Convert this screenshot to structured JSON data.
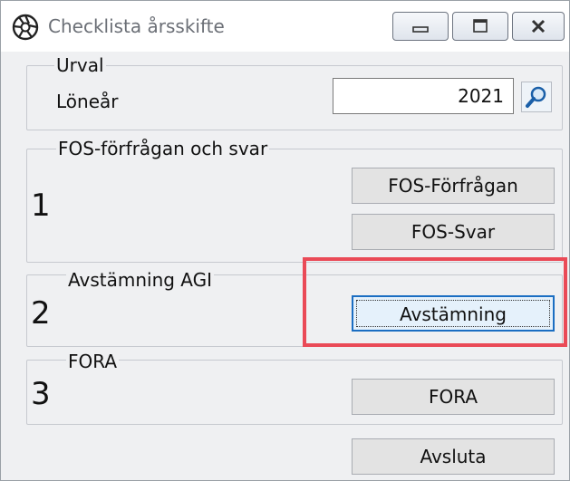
{
  "window": {
    "title": "Checklista årsskifte",
    "icon": "aperture-icon",
    "controls": [
      "minimize-icon",
      "maximize-icon",
      "close-icon"
    ]
  },
  "urval": {
    "legend": "Urval",
    "lonear_label": "Löneår",
    "lonear_value": "2021",
    "search_icon": "search-icon"
  },
  "fos": {
    "legend": "FOS-förfrågan och svar",
    "number": "1",
    "forfragan_button": "FOS-Förfrågan",
    "svar_button": "FOS-Svar"
  },
  "agi": {
    "legend": "Avstämning AGI",
    "number": "2",
    "avstamning_button": "Avstämning"
  },
  "fora": {
    "legend": "FORA",
    "number": "3",
    "fora_button": "FORA"
  },
  "footer": {
    "avsluta_button": "Avsluta"
  },
  "colors": {
    "highlight": "#ea4a57",
    "focus": "#1b6ec2",
    "window_bg": "#eff0f2"
  }
}
